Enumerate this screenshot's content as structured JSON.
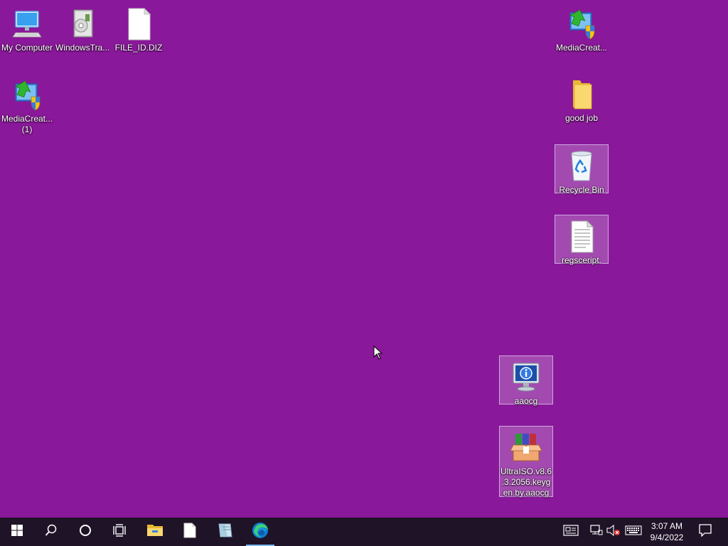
{
  "desktop": {
    "background_color": "#8a189a",
    "icons": {
      "my_computer": {
        "label": "My Computer",
        "icon": "computer-icon"
      },
      "windows_tra": {
        "label": "WindowsTra...",
        "icon": "installer-package-icon"
      },
      "file_id_diz": {
        "label": "FILE_ID.DIZ",
        "icon": "blank-file-icon"
      },
      "mediacreat_1": {
        "label": "MediaCreat... (1)",
        "icon": "media-creation-tool-icon"
      },
      "mediacreat": {
        "label": "MediaCreat...",
        "icon": "media-creation-tool-icon"
      },
      "good_job": {
        "label": "good job",
        "icon": "folder-icon"
      },
      "recycle_bin": {
        "label": "Recycle Bin",
        "icon": "recycle-bin-icon"
      },
      "regscript": {
        "label": "regsceript.",
        "icon": "text-document-icon"
      },
      "aaocg": {
        "label": "aaocg",
        "icon": "system-info-monitor-icon"
      },
      "ultraiso": {
        "label": "UltraISO.v8.6.3.2056.keygen.by.aaocg",
        "icon": "winrar-archive-icon"
      }
    }
  },
  "taskbar": {
    "start": "windows-logo-icon",
    "search": "search-icon",
    "cortana": "cortana-circle-icon",
    "task_view": "task-view-icon",
    "pinned": [
      "file-explorer-icon",
      "blank-file-icon",
      "notepad-like-icon",
      "edge-browser-icon"
    ],
    "tray": [
      "news-interests-icon",
      "network-icon",
      "volume-muted-icon",
      "touch-keyboard-icon"
    ],
    "clock": {
      "time": "3:07 AM",
      "date": "9/4/2022"
    },
    "notification": "action-center-icon"
  }
}
